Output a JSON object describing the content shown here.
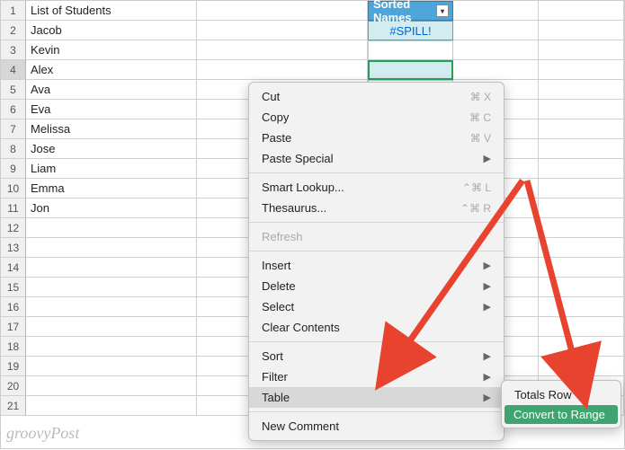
{
  "columnA_header": "List of Students",
  "columnC_header": "Sorted Names",
  "spill_error": "#SPILL!",
  "students": [
    "Jacob",
    "Kevin",
    "Alex",
    "Ava",
    "Eva",
    "Melissa",
    "Jose",
    "Liam",
    "Emma",
    "Jon"
  ],
  "row_numbers": [
    "1",
    "2",
    "3",
    "4",
    "5",
    "6",
    "7",
    "8",
    "9",
    "10",
    "11",
    "12",
    "13",
    "14",
    "15",
    "16",
    "17",
    "18",
    "19",
    "20",
    "21"
  ],
  "menu": {
    "cut": "Cut",
    "cut_sc": "⌘ X",
    "copy": "Copy",
    "copy_sc": "⌘ C",
    "paste": "Paste",
    "paste_sc": "⌘ V",
    "paste_special": "Paste Special",
    "smart_lookup": "Smart Lookup...",
    "smart_sc": "⌃⌘ L",
    "thesaurus": "Thesaurus...",
    "thes_sc": "⌃⌘ R",
    "refresh": "Refresh",
    "insert": "Insert",
    "delete": "Delete",
    "select": "Select",
    "clear": "Clear Contents",
    "sort": "Sort",
    "filter": "Filter",
    "table": "Table",
    "new_comment": "New Comment"
  },
  "submenu": {
    "totals": "Totals Row",
    "convert": "Convert to Range"
  },
  "watermark": "groovyPost"
}
